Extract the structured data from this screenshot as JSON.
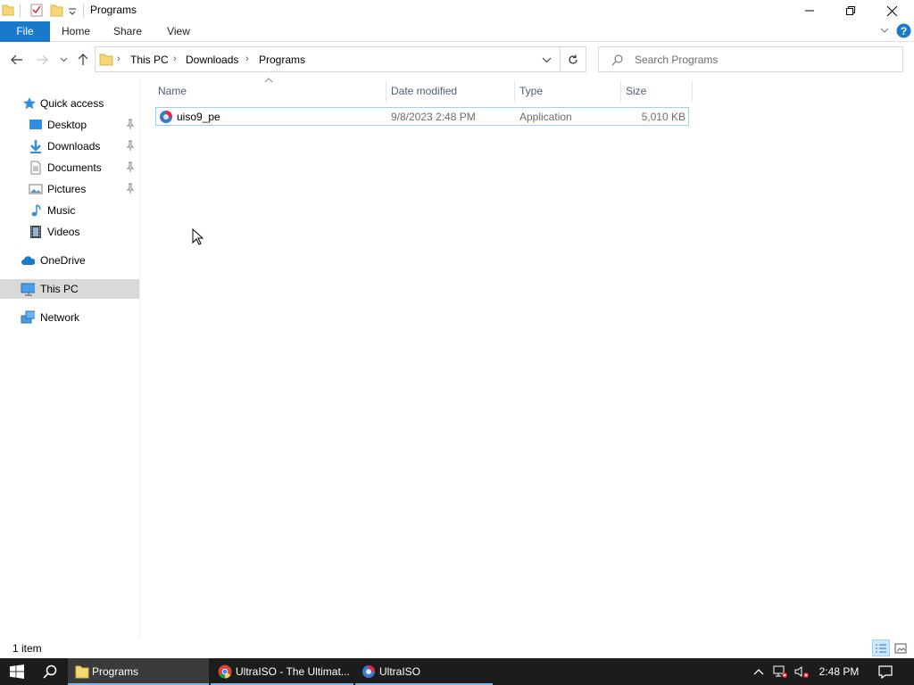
{
  "window": {
    "title": "Programs"
  },
  "ribbon": {
    "tabs": [
      "File",
      "Home",
      "Share",
      "View"
    ]
  },
  "address": {
    "crumbs": [
      "This PC",
      "Downloads",
      "Programs"
    ]
  },
  "search": {
    "placeholder": "Search Programs"
  },
  "nav": {
    "quick_access": "Quick access",
    "items": [
      "Desktop",
      "Downloads",
      "Documents",
      "Pictures",
      "Music",
      "Videos"
    ],
    "onedrive": "OneDrive",
    "this_pc": "This PC",
    "network": "Network"
  },
  "columns": {
    "name": "Name",
    "date": "Date modified",
    "type": "Type",
    "size": "Size"
  },
  "files": [
    {
      "name": "uiso9_pe",
      "date": "9/8/2023 2:48 PM",
      "type": "Application",
      "size": "5,010 KB"
    }
  ],
  "status": {
    "count": "1 item"
  },
  "taskbar": {
    "apps": [
      "Programs",
      "UltraISO - The Ultimat...",
      "UltraISO"
    ],
    "clock": "2:48 PM"
  },
  "colors": {
    "file_tab": "#1979ca",
    "selection_border": "#99d1ff",
    "taskbar": "#1c1c1c"
  }
}
